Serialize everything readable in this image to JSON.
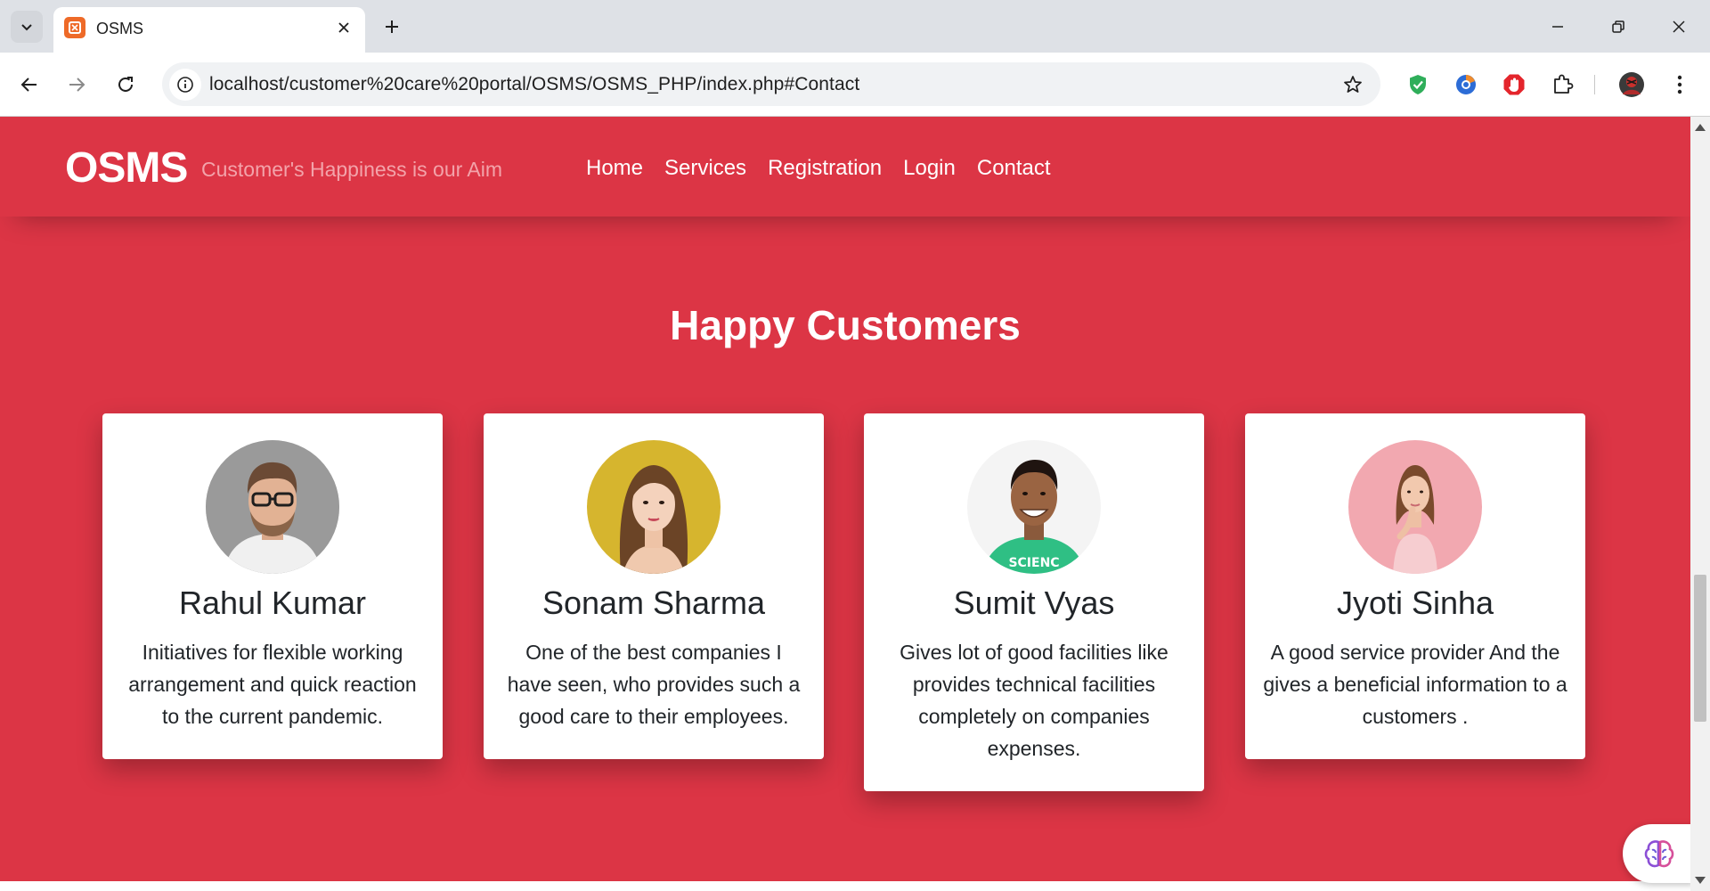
{
  "browser": {
    "tab_title": "OSMS",
    "url": "localhost/customer%20care%20portal/OSMS/OSMS_PHP/index.php#Contact",
    "icons": [
      "tab-search-icon",
      "favicon-icon",
      "close-icon",
      "plus-icon",
      "minimize-icon",
      "restore-icon",
      "window-close-icon",
      "back-icon",
      "forward-icon",
      "reload-icon",
      "site-info-icon",
      "star-icon",
      "shield-extension-icon",
      "browser-extension-icon",
      "adblock-extension-icon",
      "extensions-puzzle-icon",
      "profile-avatar-icon",
      "menu-dots-icon"
    ]
  },
  "site": {
    "brand": "OSMS",
    "tagline": "Customer's Happiness is our Aim",
    "nav": [
      "Home",
      "Services",
      "Registration",
      "Login",
      "Contact"
    ],
    "section_title": "Happy Customers",
    "customers": [
      {
        "name": "Rahul Kumar",
        "text": "Initiatives for flexible working arrangement and quick reaction to the current pandemic."
      },
      {
        "name": "Sonam Sharma",
        "text": "One of the best companies I have seen, who provides such a good care to their employees."
      },
      {
        "name": "Sumit Vyas",
        "text": "Gives lot of good facilities like provides technical facilities completely on companies expenses."
      },
      {
        "name": "Jyoti Sinha",
        "text": "A good service provider And the gives a beneficial information to a customers ."
      }
    ]
  },
  "colors": {
    "primary": "#dc3545",
    "tagline": "#f3a3aa",
    "card": "#ffffff",
    "text": "#212529"
  }
}
